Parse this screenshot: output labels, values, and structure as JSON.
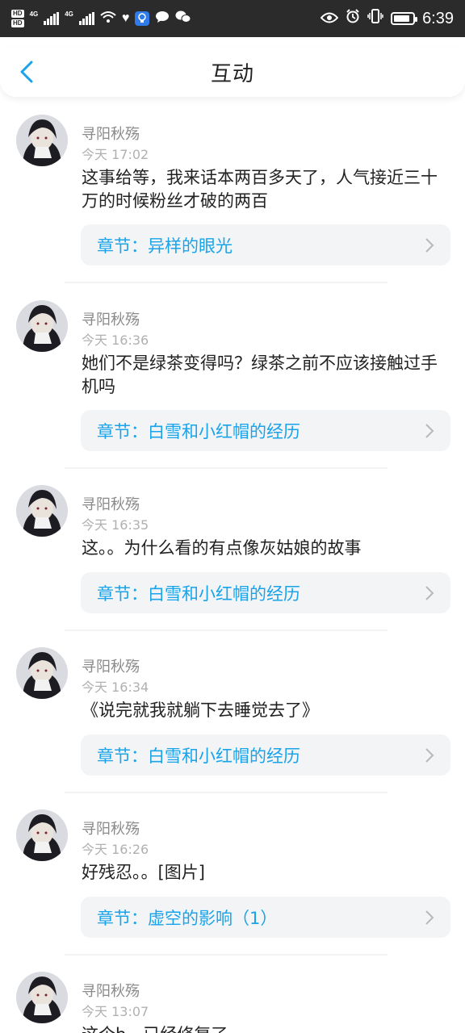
{
  "status_bar": {
    "time": "6:39",
    "network_1": "4G",
    "network_2": "4G",
    "hd1": "HD",
    "hd2": "HD"
  },
  "header": {
    "title": "互动"
  },
  "items": [
    {
      "name": "寻阳秋殇",
      "time": "今天 17:02",
      "message": "这事给等，我来话本两百多天了，人气接近三十万的时候粉丝才破的两百",
      "chapter": "章节：异样的眼光"
    },
    {
      "name": "寻阳秋殇",
      "time": "今天 16:36",
      "message": "她们不是绿茶变得吗？绿茶之前不应该接触过手机吗",
      "chapter": "章节：白雪和小红帽的经历"
    },
    {
      "name": "寻阳秋殇",
      "time": "今天 16:35",
      "message": "这。。为什么看的有点像灰姑娘的故事",
      "chapter": "章节：白雪和小红帽的经历"
    },
    {
      "name": "寻阳秋殇",
      "time": "今天 16:34",
      "message": "《说完就我就躺下去睡觉去了》",
      "chapter": "章节：白雪和小红帽的经历"
    },
    {
      "name": "寻阳秋殇",
      "time": "今天 16:26",
      "message": "好残忍。。[图片]",
      "chapter": "章节：虚空的影响（1）"
    },
    {
      "name": "寻阳秋殇",
      "time": "今天 13:07",
      "message": "这个b，已经修复了",
      "chapter": ""
    }
  ]
}
